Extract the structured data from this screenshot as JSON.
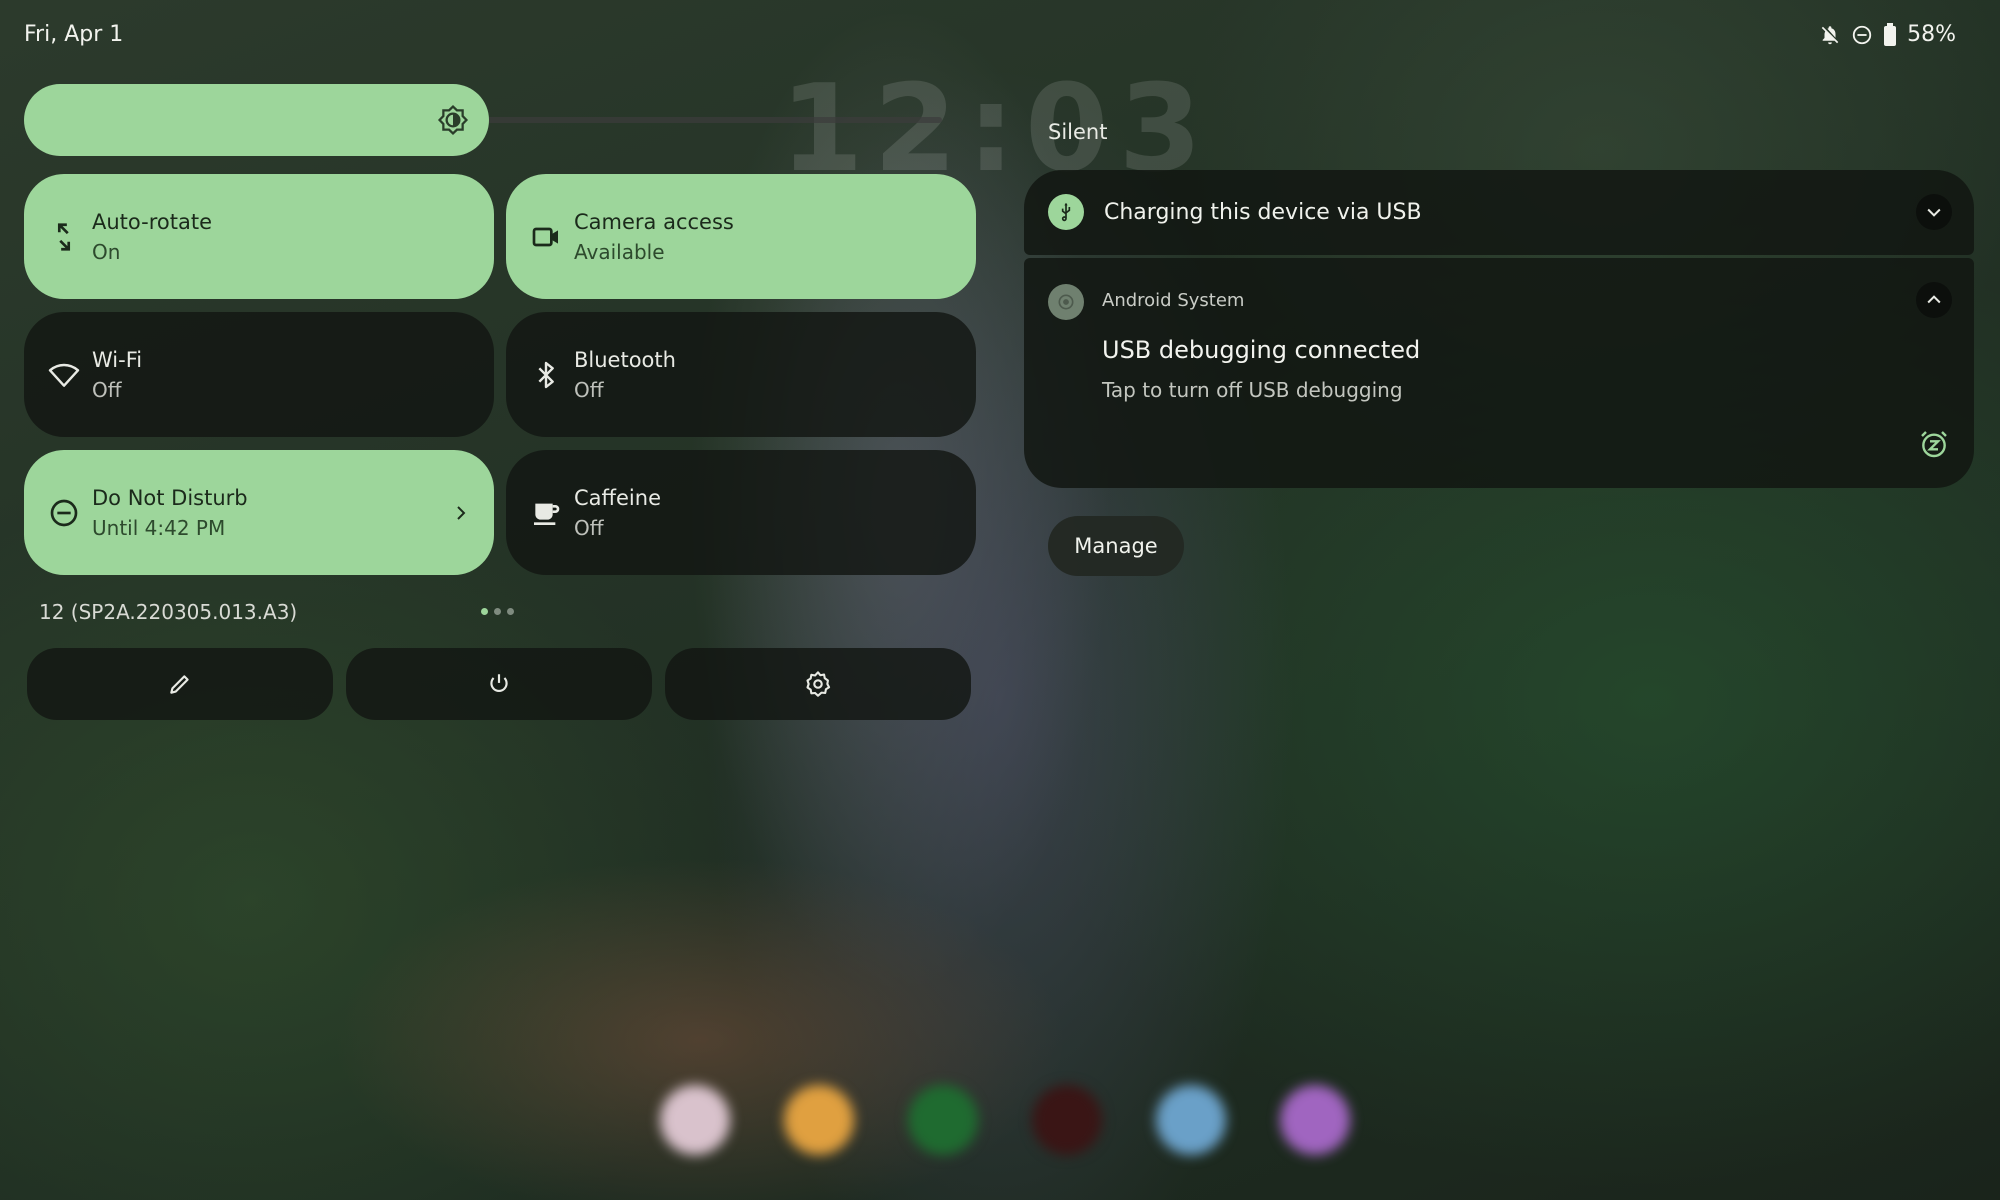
{
  "status_bar": {
    "date": "Fri, Apr 1",
    "battery": "58%",
    "icons": [
      "bell-off-icon",
      "do-not-disturb-icon",
      "battery-icon"
    ]
  },
  "background": {
    "clock_ghost": "12:03"
  },
  "quick_settings": {
    "brightness": {
      "icon": "brightness-icon",
      "level": 0.5
    },
    "tiles": [
      {
        "label": "Auto-rotate",
        "state": "On",
        "active": true,
        "icon": "rotate-icon"
      },
      {
        "label": "Camera access",
        "state": "Available",
        "active": true,
        "icon": "camera-icon"
      },
      {
        "label": "Wi-Fi",
        "state": "Off",
        "active": false,
        "icon": "wifi-icon"
      },
      {
        "label": "Bluetooth",
        "state": "Off",
        "active": false,
        "icon": "bluetooth-icon"
      },
      {
        "label": "Do Not Disturb",
        "state": "Until 4:42 PM",
        "active": true,
        "icon": "do-not-disturb-icon"
      },
      {
        "label": "Caffeine",
        "state": "Off",
        "active": false,
        "icon": "coffee-cup-icon"
      }
    ],
    "build_number": "12 (SP2A.220305.013.A3)",
    "page_indicator": {
      "pages": 3,
      "current": 0
    },
    "footer_buttons": [
      "edit-icon",
      "power-icon",
      "settings-icon"
    ]
  },
  "notifications": {
    "section_label": "Silent",
    "usb_charging": {
      "title": "Charging this device via USB",
      "icon": "usb-icon"
    },
    "usb_debugging": {
      "app_name": "Android System",
      "title": "USB debugging connected",
      "body": "Tap to turn off USB debugging",
      "icon": "android-system-icon"
    },
    "manage_label": "Manage"
  },
  "colors": {
    "accent_green": "#9dd69b",
    "tile_dark": "#121612",
    "text_light": "#e8eae4"
  }
}
